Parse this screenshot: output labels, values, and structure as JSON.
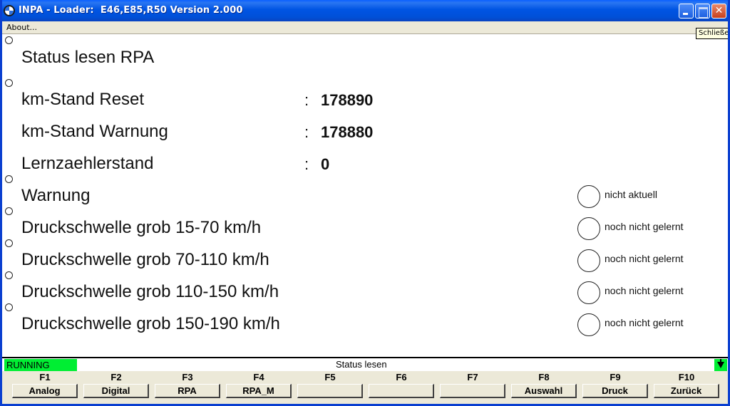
{
  "window": {
    "title": "INPA - Loader:  E46,E85,R50 Version 2.000",
    "tooltip": "Schließen"
  },
  "menu": {
    "items": [
      "About..."
    ]
  },
  "main": {
    "heading": "Status lesen RPA",
    "values": [
      {
        "label": "km-Stand Reset",
        "colon": ":",
        "value": "178890"
      },
      {
        "label": "km-Stand Warnung",
        "colon": ":",
        "value": "178880"
      },
      {
        "label": "Lernzaehlerstand",
        "colon": ":",
        "value": "0"
      }
    ],
    "indicators": [
      {
        "label": "Warnung",
        "state": "nicht aktuell"
      },
      {
        "label": "Druckschwelle grob 15-70 km/h",
        "state": "noch nicht gelernt"
      },
      {
        "label": "Druckschwelle grob 70-110 km/h",
        "state": "noch nicht gelernt"
      },
      {
        "label": "Druckschwelle grob 110-150 km/h",
        "state": "noch nicht gelernt"
      },
      {
        "label": "Druckschwelle grob 150-190 km/h",
        "state": "noch nicht gelernt"
      }
    ]
  },
  "status": {
    "running": "RUNNING",
    "text": "Status lesen",
    "running_color": "#00ee33"
  },
  "fkeys": [
    {
      "key": "F1",
      "label": "Analog"
    },
    {
      "key": "F2",
      "label": "Digital"
    },
    {
      "key": "F3",
      "label": "RPA"
    },
    {
      "key": "F4",
      "label": "RPA_M"
    },
    {
      "key": "F5",
      "label": ""
    },
    {
      "key": "F6",
      "label": ""
    },
    {
      "key": "F7",
      "label": ""
    },
    {
      "key": "F8",
      "label": "Auswahl"
    },
    {
      "key": "F9",
      "label": "Druck"
    },
    {
      "key": "F10",
      "label": "Zurück"
    }
  ]
}
